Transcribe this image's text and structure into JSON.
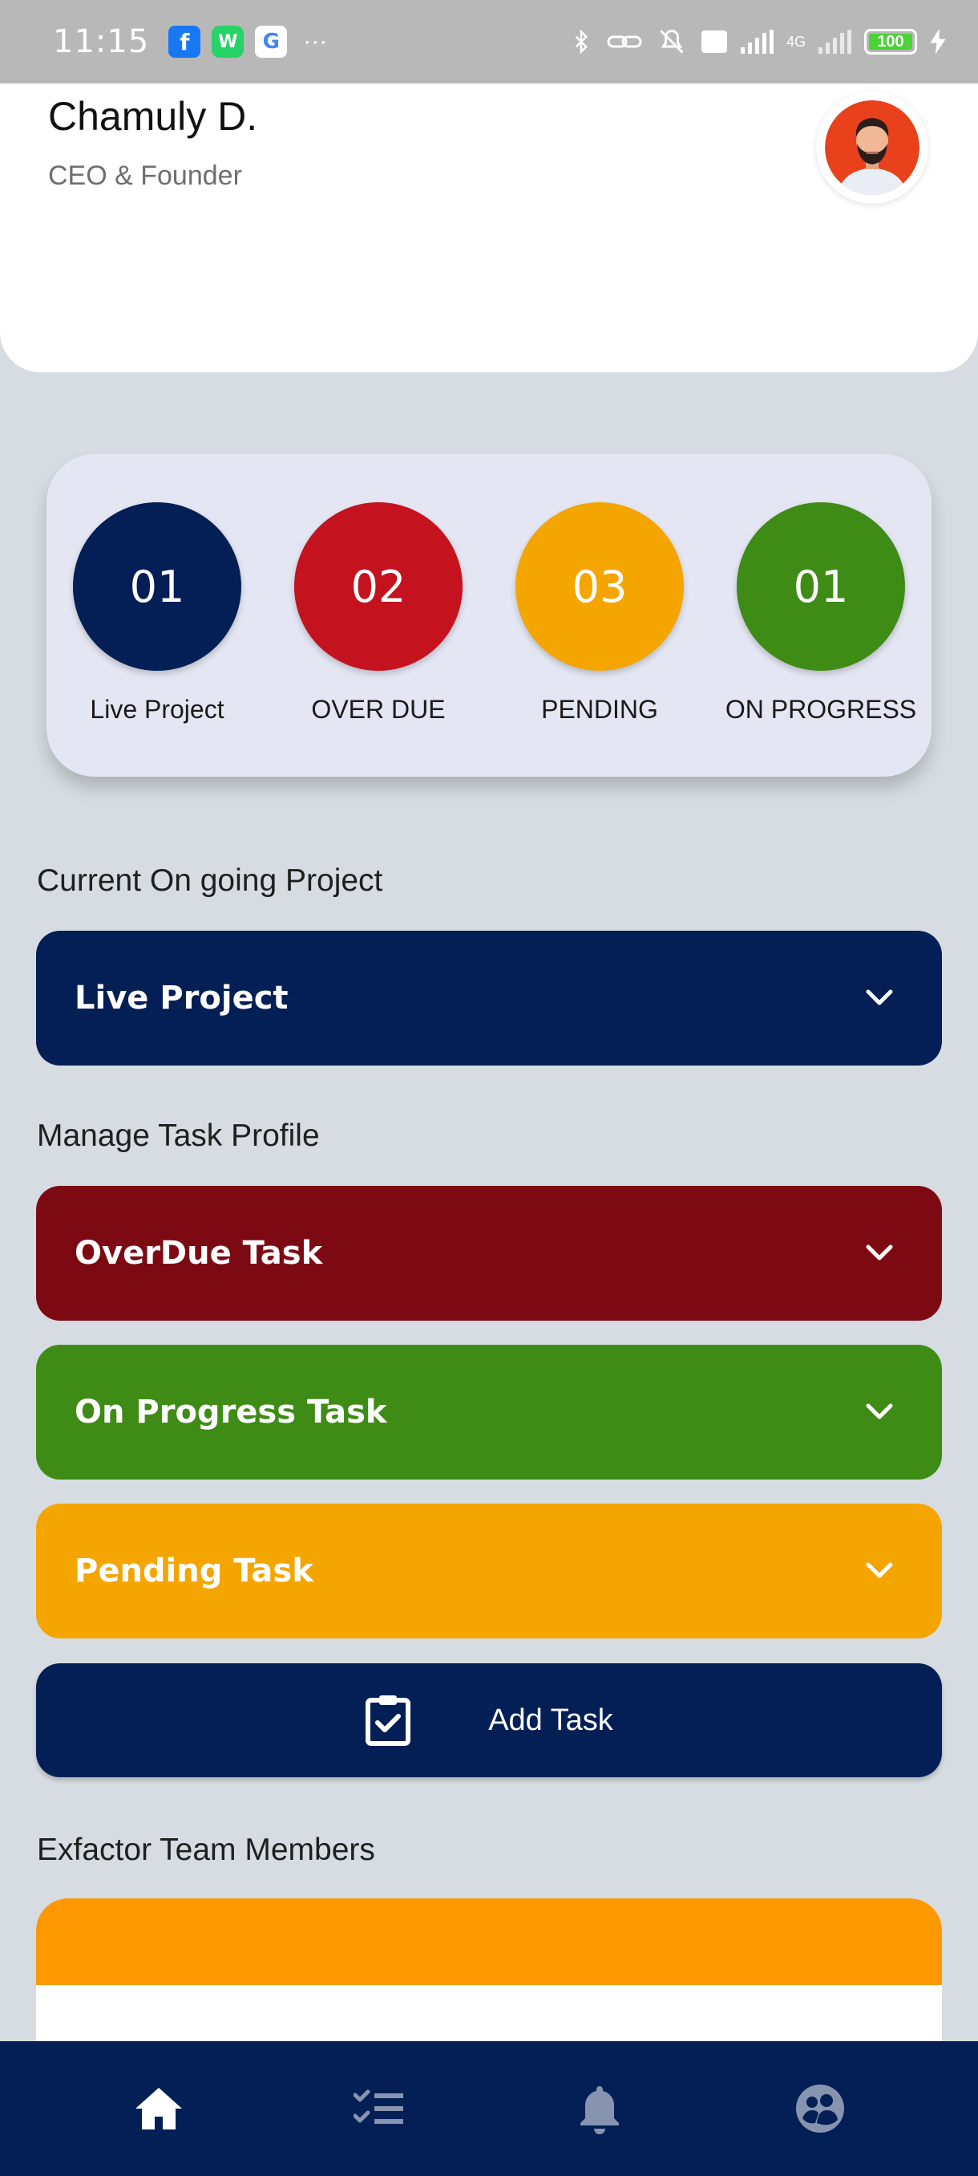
{
  "status_bar": {
    "time": "11:15",
    "apps": [
      "f",
      "W",
      "G"
    ],
    "more": "···",
    "network": "4G",
    "battery": "100"
  },
  "header": {
    "name": "Chamuly D.",
    "role": "CEO & Founder",
    "avatar_icon": "user-avatar"
  },
  "stats": [
    {
      "value": "01",
      "label": "Live Project",
      "color": "#031f56"
    },
    {
      "value": "02",
      "label": "OVER DUE",
      "color": "#c4121f"
    },
    {
      "value": "03",
      "label": "PENDING",
      "color": "#f5a500"
    },
    {
      "value": "01",
      "label": "ON PROGRESS",
      "color": "#3e8c16"
    }
  ],
  "sections": {
    "current_project": "Current On going Project",
    "manage_task": "Manage Task Profile",
    "team_members": "Exfactor Team Members"
  },
  "accordions": {
    "live_project": {
      "label": "Live Project",
      "color": "#031f56"
    },
    "overdue": {
      "label": "OverDue Task",
      "color": "#7d0a13"
    },
    "on_progress": {
      "label": "On Progress Task",
      "color": "#3e8c16"
    },
    "pending": {
      "label": "Pending Task",
      "color": "#f5a500"
    }
  },
  "add_task": {
    "label": "Add Task",
    "icon": "clipboard-check-icon"
  },
  "bottom_nav": [
    {
      "icon": "home-icon",
      "active": true
    },
    {
      "icon": "checklist-icon",
      "active": false
    },
    {
      "icon": "bell-icon",
      "active": false
    },
    {
      "icon": "team-icon",
      "active": false
    }
  ]
}
